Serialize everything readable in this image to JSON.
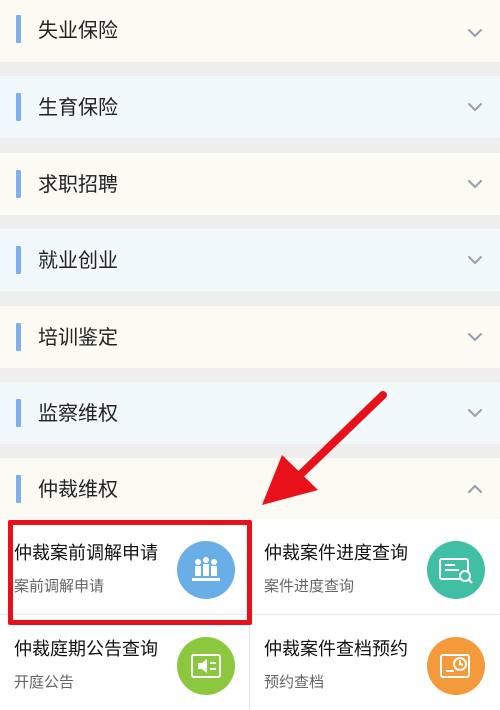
{
  "sections": [
    {
      "label": "失业保险",
      "bg": "#fbfaf3",
      "expanded": false
    },
    {
      "label": "生育保险",
      "bg": "#f1f9fb",
      "expanded": false
    },
    {
      "label": "求职招聘",
      "bg": "#fbfaf3",
      "expanded": false
    },
    {
      "label": "就业创业",
      "bg": "#f1f9fb",
      "expanded": false
    },
    {
      "label": "培训鉴定",
      "bg": "#fbfaf3",
      "expanded": false
    },
    {
      "label": "监察维权",
      "bg": "#f1f9fb",
      "expanded": false
    },
    {
      "label": "仲裁维权",
      "bg": "#fbfaf3",
      "expanded": true
    }
  ],
  "services": [
    {
      "title": "仲裁案前调解申请",
      "subtitle": "案前调解申请",
      "icon": "mediation-people-icon",
      "color": "#6aaee8"
    },
    {
      "title": "仲裁案件进度查询",
      "subtitle": "案件进度查询",
      "icon": "progress-card-icon",
      "color": "#41bfa5"
    },
    {
      "title": "仲裁庭期公告查询",
      "subtitle": "开庭公告",
      "icon": "announcement-speaker-icon",
      "color": "#8cc83f"
    },
    {
      "title": "仲裁案件查档预约",
      "subtitle": "预约查档",
      "icon": "appointment-clock-icon",
      "color": "#f59a3a"
    }
  ],
  "annotation": {
    "highlight_color": "#e8111b"
  }
}
